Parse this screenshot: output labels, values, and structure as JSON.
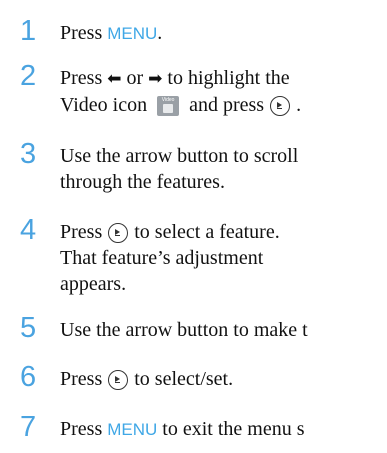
{
  "steps": [
    {
      "number": "1",
      "pre": "Press ",
      "key": "MENU",
      "post": "."
    },
    {
      "number": "2",
      "line1_pre": "Press ",
      "arrow_left": "◆",
      "or": " or ",
      "arrow_right": "◆",
      "line1_post": " to highlight the",
      "line2_pre": "Video icon",
      "video_label": "Video",
      "line2_mid": "and press",
      "line2_post": "."
    },
    {
      "number": "3",
      "line1": "Use the arrow button to scroll",
      "line2": "through the features."
    },
    {
      "number": "4",
      "line1_pre": "Press",
      "line1_post": "to select a feature.",
      "line2": "That feature’s adjustment",
      "line3": "appears."
    },
    {
      "number": "5",
      "text": "Use the arrow button to make t"
    },
    {
      "number": "6",
      "pre": "Press",
      "post": "to select/set."
    },
    {
      "number": "7",
      "pre": "Press ",
      "key": "MENU",
      "post": " to exit the menu s"
    }
  ]
}
